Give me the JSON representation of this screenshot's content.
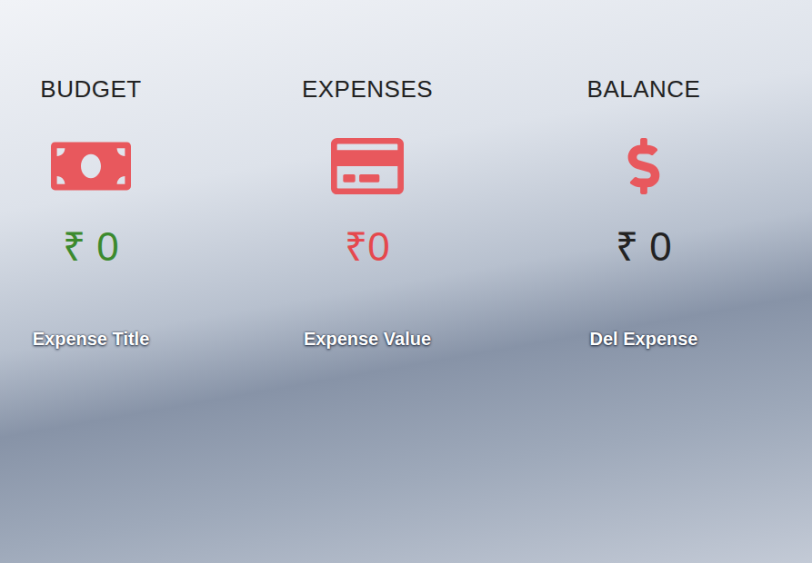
{
  "cards": [
    {
      "kind": "budget",
      "title": "BUDGET",
      "amount": "₹ 0",
      "color": "#3c8a2e"
    },
    {
      "kind": "expenses",
      "title": "EXPENSES",
      "amount": "₹0",
      "color": "#e5484d"
    },
    {
      "kind": "balance",
      "title": "BALANCE",
      "amount": "₹ 0",
      "color": "#222222"
    }
  ],
  "expense_list": {
    "columns": [
      "Expense Title",
      "Expense Value",
      "Del Expense"
    ]
  }
}
